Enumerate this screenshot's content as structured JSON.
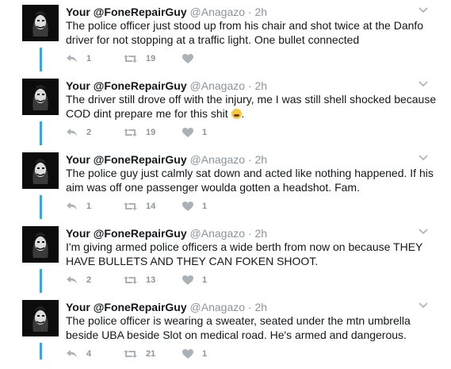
{
  "tweets": [
    {
      "name": "Your @FoneRepairGuy",
      "handle": "@Anagazo",
      "separator": "·",
      "time": "2h",
      "text": "The police officer just stood up from his chair and shot twice at the Danfo driver for not stopping at a traffic light. One bullet connected",
      "replies": "1",
      "retweets": "19",
      "likes": ""
    },
    {
      "name": "Your @FoneRepairGuy",
      "handle": "@Anagazo",
      "separator": "·",
      "time": "2h",
      "text": "The driver still drove off with the injury, me I was still shell shocked because COD dint prepare me for this shit",
      "text_suffix": ".",
      "emoji_name": "weary-face-emoji",
      "replies": "2",
      "retweets": "19",
      "likes": "1"
    },
    {
      "name": "Your @FoneRepairGuy",
      "handle": "@Anagazo",
      "separator": "·",
      "time": "2h",
      "text": "The police guy just calmly sat down and acted like nothing happened. If his aim was off one passenger woulda gotten a headshot. Fam.",
      "replies": "1",
      "retweets": "14",
      "likes": "1"
    },
    {
      "name": "Your @FoneRepairGuy",
      "handle": "@Anagazo",
      "separator": "·",
      "time": "2h",
      "text": "I'm giving armed police officers a wide berth from now on because THEY HAVE BULLETS AND THEY CAN FOKEN SHOOT.",
      "replies": "2",
      "retweets": "13",
      "likes": "1"
    },
    {
      "name": "Your @FoneRepairGuy",
      "handle": "@Anagazo",
      "separator": "·",
      "time": "2h",
      "text": "The police officer is wearing a sweater, seated under the mtn umbrella beside UBA beside Slot on medical road. He's armed and dangerous.",
      "replies": "4",
      "retweets": "21",
      "likes": "1"
    }
  ],
  "icons": {
    "avatar": "joker-avatar",
    "reply": "reply-icon",
    "retweet": "retweet-icon",
    "like": "heart-icon",
    "menu": "chevron-down-icon"
  },
  "colors": {
    "thread_line": "#3aa6dc",
    "muted": "#8a949d",
    "text": "#14171a"
  }
}
